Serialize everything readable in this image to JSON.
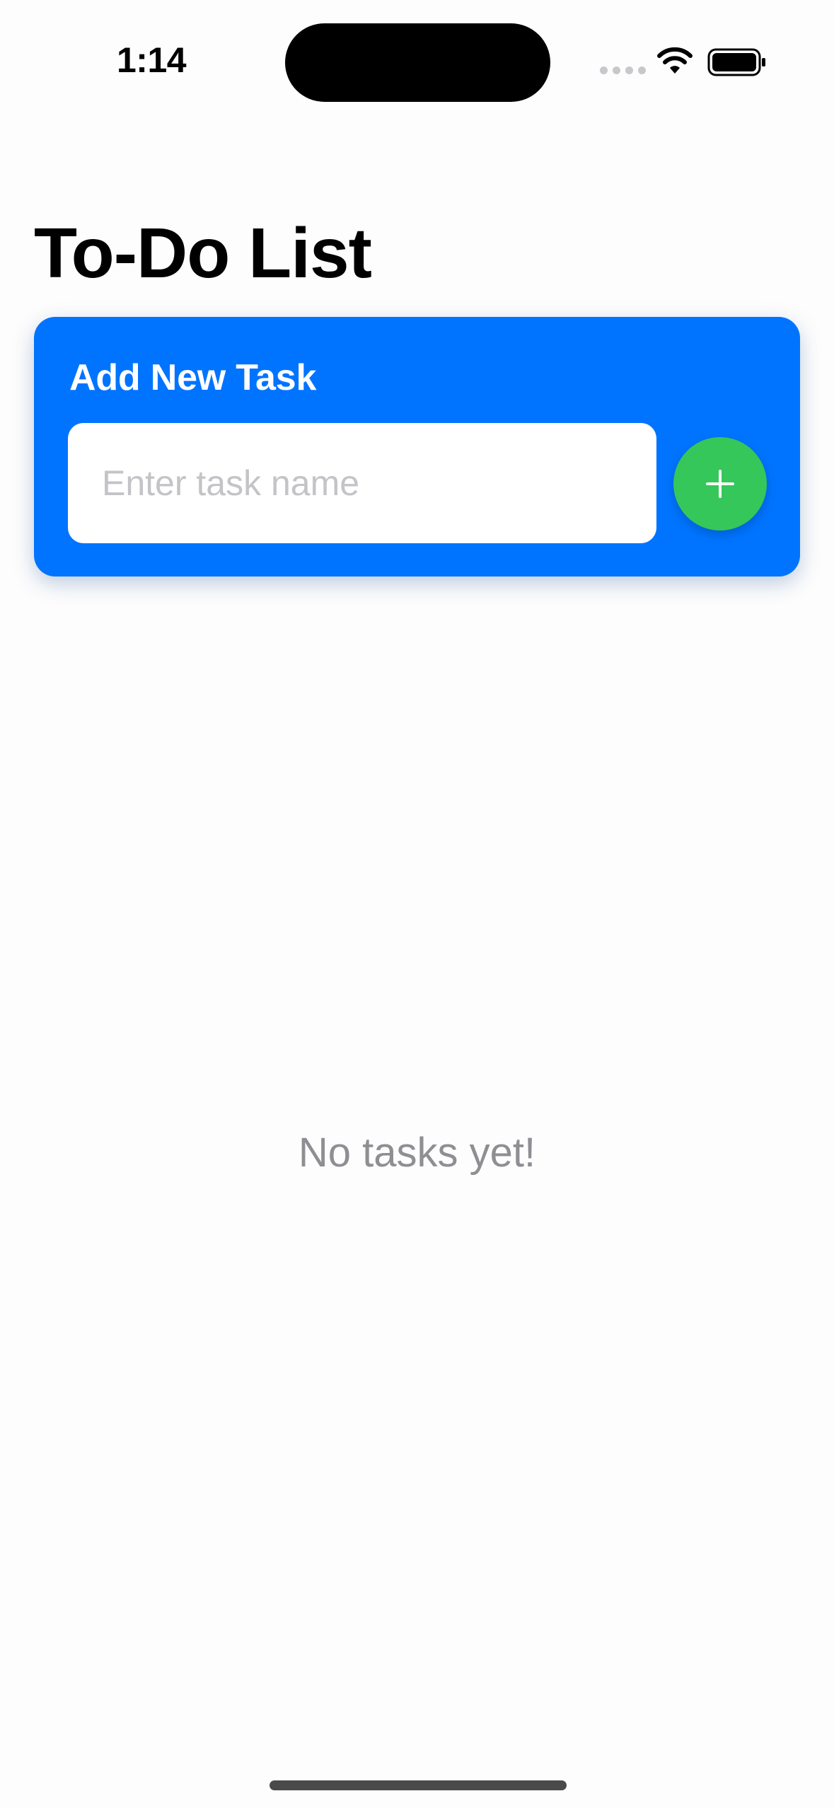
{
  "status_bar": {
    "time": "1:14",
    "icons": [
      "cellular-signal-icon",
      "wifi-icon",
      "battery-icon"
    ]
  },
  "page": {
    "title": "To-Do List"
  },
  "add_card": {
    "title": "Add New Task",
    "input_placeholder": "Enter task name",
    "input_value": "",
    "add_button_icon": "plus-icon",
    "background_color": "#0174FF",
    "button_color": "#35C759"
  },
  "empty_state": {
    "message": "No tasks yet!"
  }
}
